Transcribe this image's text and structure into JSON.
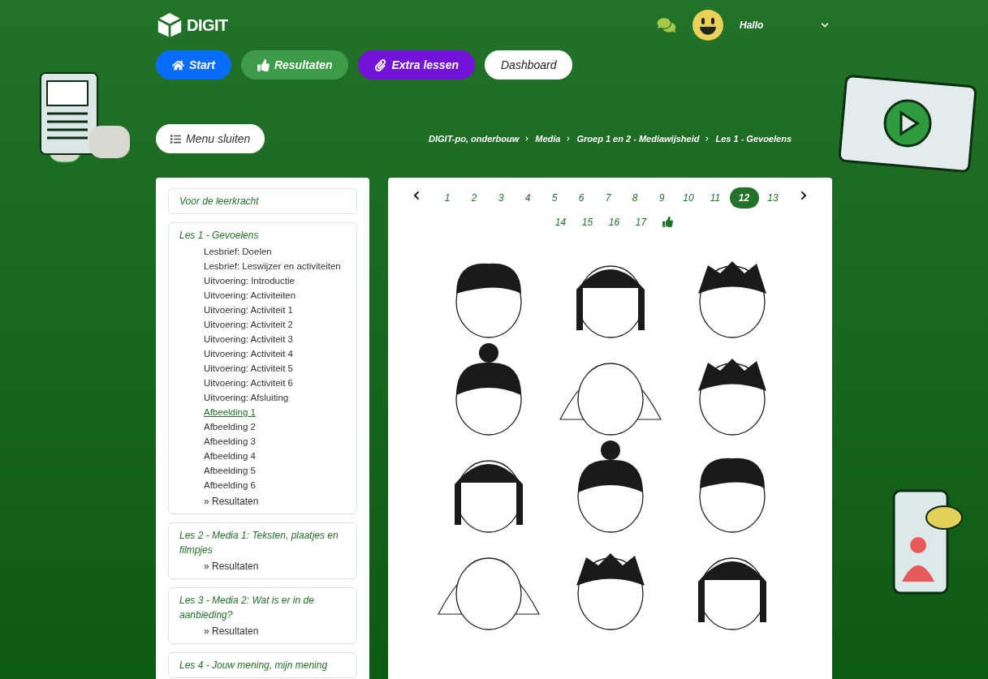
{
  "header": {
    "logo": "DIGIT",
    "greeting": "Hallo"
  },
  "nav": [
    {
      "label": "Start",
      "kind": "home",
      "color": "#0a6cff"
    },
    {
      "label": "Resultaten",
      "kind": "thumb",
      "color": "#3c9c47"
    },
    {
      "label": "Extra lessen",
      "kind": "clip",
      "color": "#7413d8"
    },
    {
      "label": "Dashboard",
      "kind": "plain",
      "color": "#ffffff"
    }
  ],
  "menu_toggle": "Menu sluiten",
  "breadcrumb": [
    "DIGIT-po, onderbouw",
    "Media",
    "Groep 1 en 2 - Mediawijsheid",
    "Les 1 - Gevoelens"
  ],
  "sidebar": {
    "sections": [
      {
        "title": "Voor de leerkracht"
      },
      {
        "title": "Les 1 - Gevoelens",
        "items": [
          {
            "label": "Lesbrief: Doelen",
            "selected": false
          },
          {
            "label": "Lesbrief: Leswijzer en activiteiten",
            "selected": false
          },
          {
            "label": "Uitvoering: Introductie",
            "selected": false
          },
          {
            "label": "Uitvoering: Activiteiten",
            "selected": false
          },
          {
            "label": "Uitvoering: Activiteit 1",
            "selected": false
          },
          {
            "label": "Uitvoering: Activiteit 2",
            "selected": false
          },
          {
            "label": "Uitvoering: Activiteit 3",
            "selected": false
          },
          {
            "label": "Uitvoering: Activiteit 4",
            "selected": false
          },
          {
            "label": "Uitvoering: Activiteit 5",
            "selected": false
          },
          {
            "label": "Uitvoering: Activiteit 6",
            "selected": false
          },
          {
            "label": "Uitvoering: Afsluiting",
            "selected": false
          },
          {
            "label": "Afbeelding 1",
            "selected": true
          },
          {
            "label": "Afbeelding 2",
            "selected": false
          },
          {
            "label": "Afbeelding 3",
            "selected": false
          },
          {
            "label": "Afbeelding 4",
            "selected": false
          },
          {
            "label": "Afbeelding 5",
            "selected": false
          },
          {
            "label": "Afbeelding 6",
            "selected": false
          }
        ],
        "results": "» Resultaten"
      },
      {
        "title": "Les 2 - Media 1: Teksten, plaatjes en filmpjes",
        "results": "» Resultaten"
      },
      {
        "title": "Les 3 - Media 2: Wat is er in de aanbieding?",
        "results": "» Resultaten"
      },
      {
        "title": "Les 4 - Jouw mening, mijn mening"
      }
    ]
  },
  "pagination": [
    {
      "label": "1",
      "selected": false
    },
    {
      "label": "2",
      "selected": false
    },
    {
      "label": "3",
      "selected": false
    },
    {
      "label": "4",
      "selected": false
    },
    {
      "label": "5",
      "selected": false
    },
    {
      "label": "6",
      "selected": false
    },
    {
      "label": "7",
      "selected": false
    },
    {
      "label": "8",
      "selected": false
    },
    {
      "label": "9",
      "selected": false
    },
    {
      "label": "10",
      "selected": false
    },
    {
      "label": "11",
      "selected": false
    },
    {
      "label": "12",
      "selected": true
    },
    {
      "label": "13",
      "selected": false
    },
    {
      "label": "14",
      "selected": false
    },
    {
      "label": "15",
      "selected": false
    },
    {
      "label": "16",
      "selected": false
    },
    {
      "label": "17",
      "selected": false
    }
  ],
  "content": {
    "kind": "picture"
  }
}
